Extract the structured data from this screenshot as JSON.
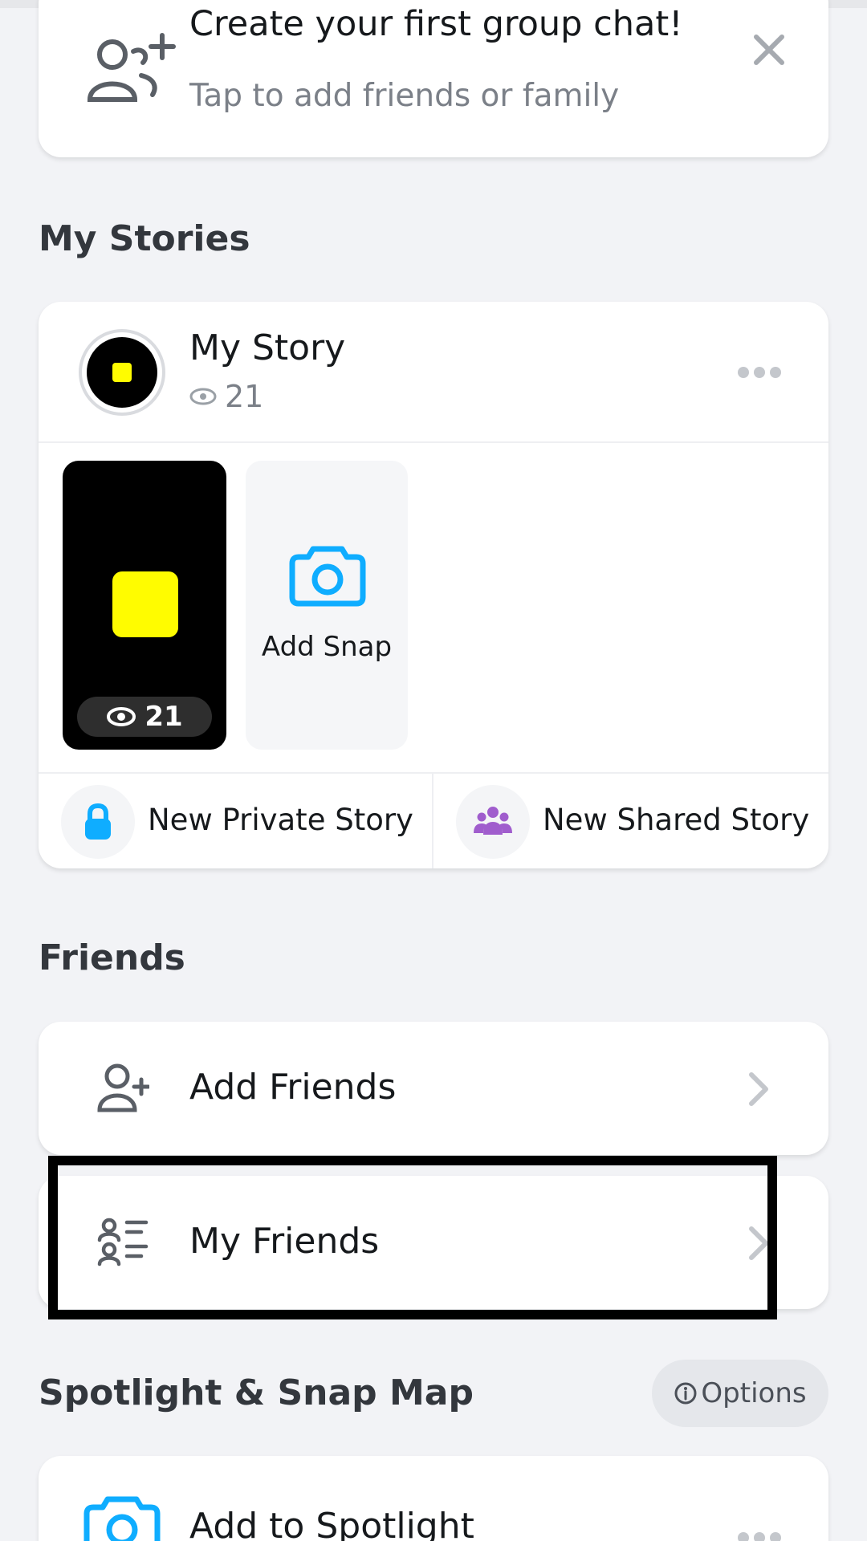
{
  "group_chat": {
    "title": "Create your first group chat!",
    "subtitle": "Tap to add friends or family"
  },
  "sections": {
    "my_stories": "My Stories",
    "friends": "Friends",
    "spotlight": "Spotlight & Snap Map"
  },
  "my_story": {
    "name": "My Story",
    "views": "21",
    "thumb_views": "21",
    "add_snap_label": "Add Snap",
    "new_private_story": "New Private Story",
    "new_shared_story": "New Shared Story"
  },
  "friends": {
    "add_friends": "Add Friends",
    "my_friends": "My Friends"
  },
  "spotlight": {
    "options_label": "Options",
    "add_to_spotlight": "Add to Spotlight"
  },
  "colors": {
    "accent_blue": "#0FADFF",
    "purple": "#A05DCD",
    "snap_yellow": "#FFFC00"
  },
  "icons": {
    "group": "add-group-icon",
    "close": "close-icon",
    "eye": "eye-icon",
    "more": "more-dots-icon",
    "camera": "camera-icon",
    "lock": "lock-icon",
    "people": "people-icon",
    "add_friend": "add-friend-icon",
    "friends_list": "friends-list-icon",
    "chevron": "chevron-right-icon",
    "info": "info-icon"
  }
}
